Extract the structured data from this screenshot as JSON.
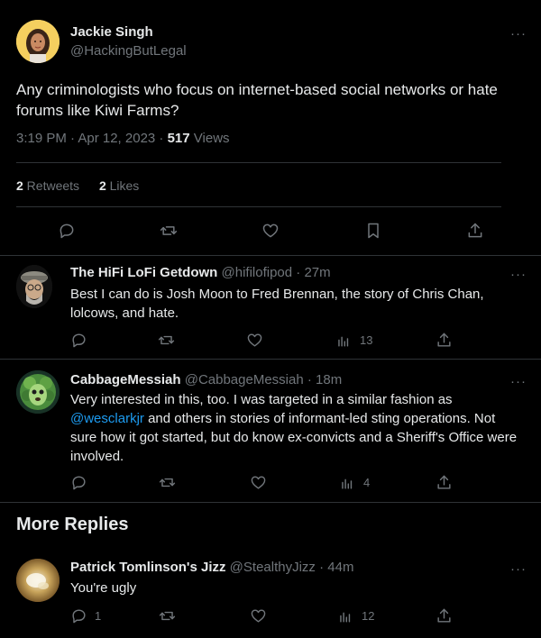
{
  "main": {
    "name": "Jackie Singh",
    "handle": "@HackingButLegal",
    "text": "Any criminologists who focus on internet-based social networks or hate forums like Kiwi Farms?",
    "time": "3:19 PM · Apr 12, 2023 · ",
    "views_count": "517",
    "views_label": " Views",
    "retweets_count": "2",
    "retweets_label": " Retweets",
    "likes_count": "2",
    "likes_label": " Likes",
    "more": "···"
  },
  "replies": [
    {
      "name": "The HiFi LoFi Getdown",
      "handle": "@hifilofipod",
      "time": " · 27m",
      "text": "Best I can do is Josh Moon to Fred Brennan, the story of Chris Chan, lolcows, and hate.",
      "views": "13"
    },
    {
      "name": "CabbageMessiah",
      "handle": "@CabbageMessiah",
      "time": " · 18m",
      "text_1": "Very interested in this, too. I was targeted in a similar fashion as ",
      "mention": "@wesclarkjr",
      "text_2": " and others in stories of informant-led sting operations. Not sure how it got started, but do know ex-convicts and a Sheriff's Office were involved.",
      "views": "4"
    },
    {
      "name": "Patrick Tomlinson's Jizz",
      "handle": "@StealthyJizz",
      "time": " · 44m",
      "text": "You're ugly",
      "replies": "1",
      "views": "12"
    }
  ],
  "section": {
    "more_replies": "More Replies"
  },
  "icons": {
    "reply": "reply-icon",
    "retweet": "retweet-icon",
    "like": "heart-icon",
    "bookmark": "bookmark-icon",
    "share": "share-icon",
    "views": "views-icon"
  },
  "colors": {
    "background": "#000000",
    "text": "#e7e9ea",
    "muted": "#71767b",
    "link": "#1d9bf0",
    "border": "#2f3336"
  }
}
